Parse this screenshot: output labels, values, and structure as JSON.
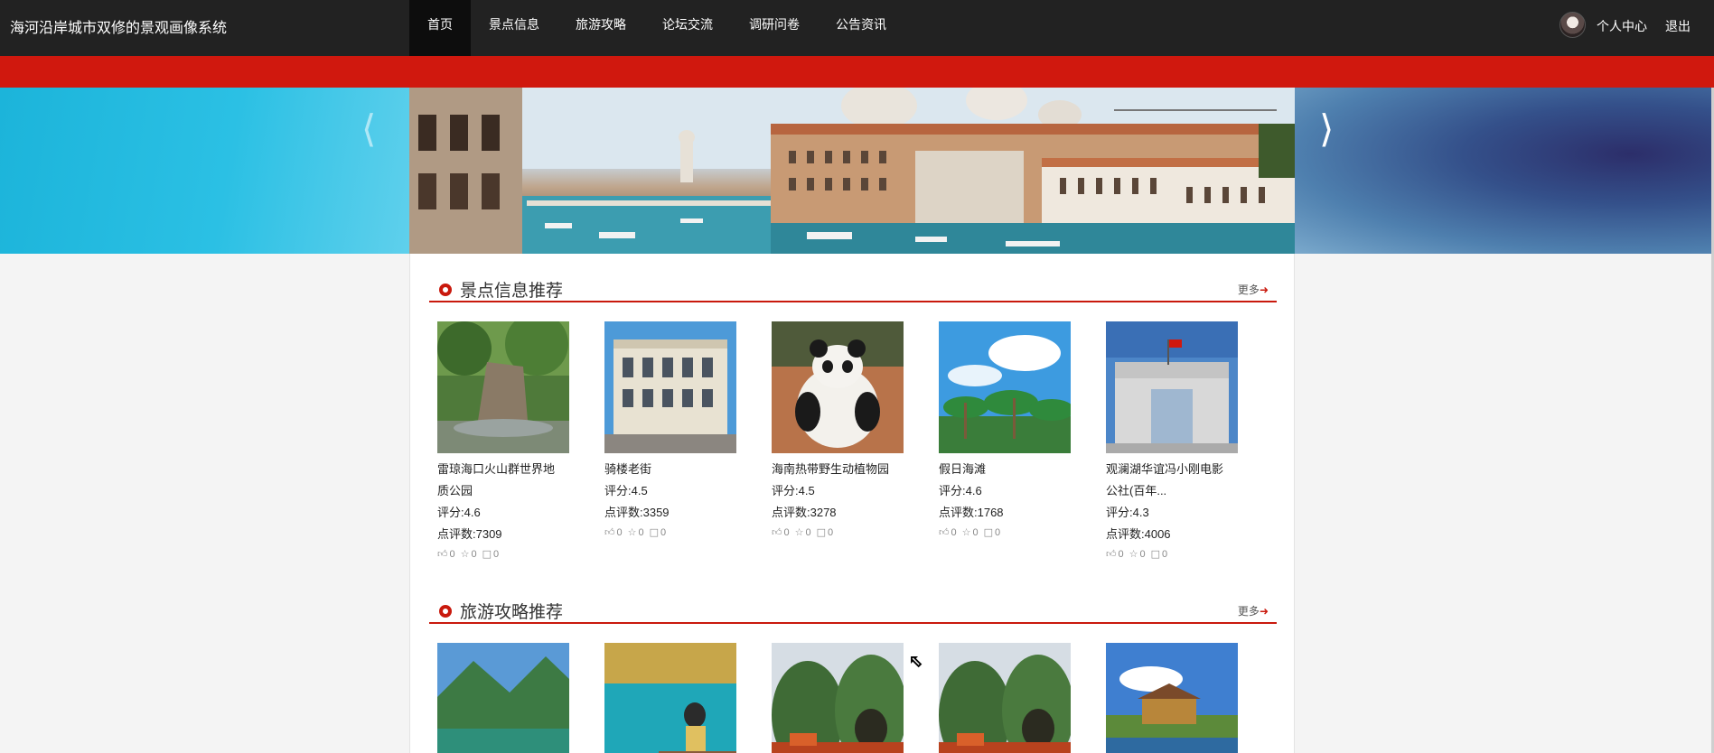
{
  "header": {
    "site_title": "海河沿岸城市双修的景观画像系统",
    "nav": [
      {
        "label": "首页",
        "active": true
      },
      {
        "label": "景点信息",
        "active": false
      },
      {
        "label": "旅游攻略",
        "active": false
      },
      {
        "label": "论坛交流",
        "active": false
      },
      {
        "label": "调研问卷",
        "active": false
      },
      {
        "label": "公告资讯",
        "active": false
      }
    ],
    "user_center": "个人中心",
    "logout": "退出"
  },
  "colors": {
    "nav_bg": "#222222",
    "accent_red": "#d0180e"
  },
  "carousel": {
    "prev_icon": "chevron-left-icon",
    "next_icon": "chevron-right-icon"
  },
  "sections": {
    "attractions": {
      "title": "景点信息推荐",
      "more": "更多",
      "items": [
        {
          "name_line1": "雷琼海口火山群世界地",
          "name_line2": "质公园",
          "rating": "评分:4.6",
          "reviews": "点评数:7309",
          "likes": "0",
          "stars": "0",
          "comments": "0"
        },
        {
          "name_line1": "骑楼老街",
          "name_line2": "",
          "rating": "评分:4.5",
          "reviews": "点评数:3359",
          "likes": "0",
          "stars": "0",
          "comments": "0"
        },
        {
          "name_line1": "海南热带野生动植物园",
          "name_line2": "",
          "rating": "评分:4.5",
          "reviews": "点评数:3278",
          "likes": "0",
          "stars": "0",
          "comments": "0"
        },
        {
          "name_line1": "假日海滩",
          "name_line2": "",
          "rating": "评分:4.6",
          "reviews": "点评数:1768",
          "likes": "0",
          "stars": "0",
          "comments": "0"
        },
        {
          "name_line1": "观澜湖华谊冯小刚电影",
          "name_line2": "公社(百年...",
          "rating": "评分:4.3",
          "reviews": "点评数:4006",
          "likes": "0",
          "stars": "0",
          "comments": "0"
        }
      ]
    },
    "guides": {
      "title": "旅游攻略推荐",
      "more": "更多"
    }
  }
}
